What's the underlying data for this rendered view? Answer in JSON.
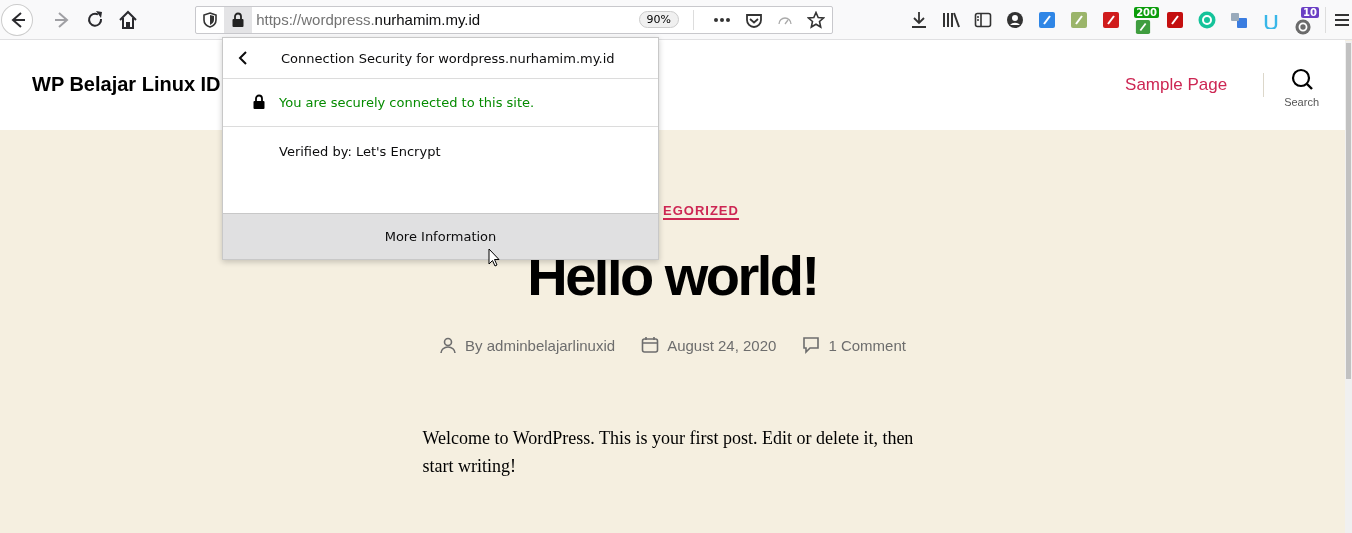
{
  "browser": {
    "nav": [
      {
        "kind": "back",
        "disabled": false
      },
      {
        "kind": "forward",
        "disabled": true
      },
      {
        "kind": "reload",
        "disabled": false
      },
      {
        "kind": "home",
        "disabled": false
      }
    ],
    "address_bar": {
      "url_muted": "https://wordpress.",
      "url_host": "nurhamim.my.id",
      "zoom": "90%"
    },
    "toolbar": [
      {
        "kind": "download"
      },
      {
        "kind": "library"
      },
      {
        "kind": "sidebar"
      },
      {
        "kind": "account"
      },
      {
        "kind": "tile",
        "color": "#2f86e6"
      },
      {
        "kind": "tile",
        "color": "#9bb56a"
      },
      {
        "kind": "tile",
        "color": "#d01c1c"
      },
      {
        "kind": "tile",
        "color": "#3f9d3f",
        "badge": "200"
      },
      {
        "kind": "tile",
        "color": "#c40f0f"
      },
      {
        "kind": "circle",
        "color": "#15c39a"
      },
      {
        "kind": "translate",
        "color": "#3b7de0"
      },
      {
        "kind": "cup",
        "color": "#39b7e8"
      },
      {
        "kind": "circle",
        "color": "#6b6b6b",
        "badge": "10"
      }
    ]
  },
  "popup": {
    "title": "Connection Security for wordpress.nurhamim.my.id",
    "status": "You are securely connected to this site.",
    "verified": "Verified by: Let's Encrypt",
    "button": "More Information"
  },
  "site": {
    "title": "WP Belajar Linux ID",
    "menu": [
      {
        "label": "Sample Page"
      }
    ],
    "search_label": "Search"
  },
  "post": {
    "category": "EGORIZED",
    "title": "Hello world!",
    "author": "By adminbelajarlinuxid",
    "date": "August 24, 2020",
    "comments": "1 Comment",
    "body": "Welcome to WordPress. This is your first post. Edit or delete it, then start writing!"
  }
}
